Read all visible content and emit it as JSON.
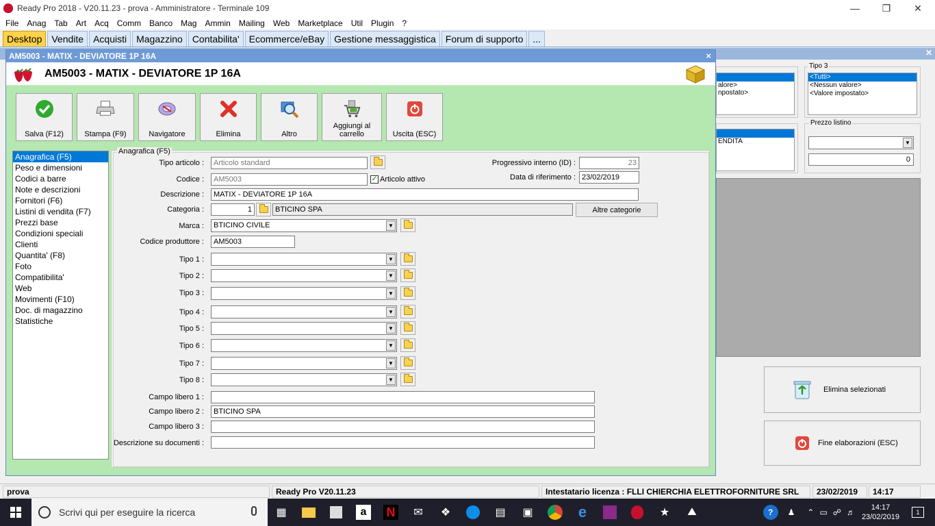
{
  "window": {
    "title": "Ready Pro 2018 - V20.11.23 - prova - Amministratore - Terminale 109"
  },
  "menu": [
    "File",
    "Anag",
    "Tab",
    "Art",
    "Acq",
    "Comm",
    "Banco",
    "Mag",
    "Ammin",
    "Mailing",
    "Web",
    "Marketplace",
    "Util",
    "Plugin",
    "?"
  ],
  "tabs": [
    "Desktop",
    "Vendite",
    "Acquisti",
    "Magazzino",
    "Contabilita'",
    "Ecommerce/eBay",
    "Gestione messaggistica",
    "Forum di supporto",
    "..."
  ],
  "background": {
    "list1_items": [
      "alore>",
      "npostato>"
    ],
    "tipo3": {
      "label": "Tipo 3",
      "items": [
        "<Tutti>",
        "<Nessun valore>",
        "<Valore impostato>"
      ]
    },
    "list2_item": "ENDITA",
    "prezzo_listino": {
      "label": "Prezzo listino",
      "value": "0"
    },
    "elimina_selezionati": "Elimina selezionati",
    "fine_elaborazioni": "Fine elaborazioni (ESC)"
  },
  "dialog": {
    "titlebar": "AM5003 - MATIX - DEVIATORE 1P 16A",
    "header": "AM5003 - MATIX - DEVIATORE 1P 16A",
    "close": "×",
    "toolbar": [
      {
        "label": "Salva (F12)",
        "icon": "check-icon"
      },
      {
        "label": "Stampa (F9)",
        "icon": "printer-icon"
      },
      {
        "label": "Navigatore",
        "icon": "navigator-icon"
      },
      {
        "label": "Elimina",
        "icon": "delete-icon"
      },
      {
        "label": "Altro",
        "icon": "magnifier-icon"
      },
      {
        "label": "Aggiungi al carrello",
        "icon": "cart-icon"
      },
      {
        "label": "Uscita (ESC)",
        "icon": "exit-icon"
      }
    ],
    "nav": [
      "Anagrafica (F5)",
      "Peso e dimensioni",
      "Codici a barre",
      "Note e descrizioni",
      "Fornitori (F6)",
      "Listini di vendita (F7)",
      "Prezzi base",
      "Condizioni speciali",
      "Clienti",
      "Quantita' (F8)",
      "Foto",
      "Compatibilita'",
      "Web",
      "Movimenti (F10)",
      "Doc. di magazzino",
      "Statistiche"
    ],
    "form": {
      "legend": "Anagrafica (F5)",
      "tipo_articolo_label": "Tipo articolo :",
      "tipo_articolo": "Articolo standard",
      "codice_label": "Codice :",
      "codice": "AM5003",
      "articolo_attivo": "Articolo attivo",
      "progressivo_label": "Progressivo interno (ID) :",
      "progressivo": "23",
      "data_rif_label": "Data di riferimento :",
      "data_rif": "23/02/2019",
      "descrizione_label": "Descrizione :",
      "descrizione": "MATIX - DEVIATORE 1P 16A",
      "categoria_label": "Categoria :",
      "categoria_num": "1",
      "categoria_nome": "BTICINO SPA",
      "altre_categorie": "Altre categorie",
      "marca_label": "Marca :",
      "marca": "BTICINO CIVILE",
      "codice_produttore_label": "Codice produttore :",
      "codice_produttore": "AM5003",
      "tipi": [
        "Tipo 1 :",
        "Tipo 2 :",
        "Tipo 3 :",
        "Tipo 4 :",
        "Tipo 5 :",
        "Tipo 6 :",
        "Tipo 7 :",
        "Tipo 8 :"
      ],
      "campo1_label": "Campo libero 1 :",
      "campo1": "",
      "campo2_label": "Campo libero 2 :",
      "campo2": "BTICINO SPA",
      "campo3_label": "Campo libero 3 :",
      "campo3": "",
      "desc_doc_label": "Descrizione su documenti :",
      "desc_doc": ""
    }
  },
  "status": {
    "db": "prova",
    "version": "Ready Pro V20.11.23",
    "licenza": "Intestatario licenza : FLLI CHIERCHIA ELETTROFORNITURE SRL",
    "date": "23/02/2019",
    "time": "14:17"
  },
  "taskbar": {
    "search_placeholder": "Scrivi qui per eseguire la ricerca",
    "clock_time": "14:17",
    "clock_date": "23/02/2019",
    "notifications": "1"
  },
  "colors": {
    "dialog_bg": "#b5e7b0",
    "title_blue": "#6e9ad6",
    "selected": "#0078d7",
    "active_tab": "#ffd24a"
  }
}
